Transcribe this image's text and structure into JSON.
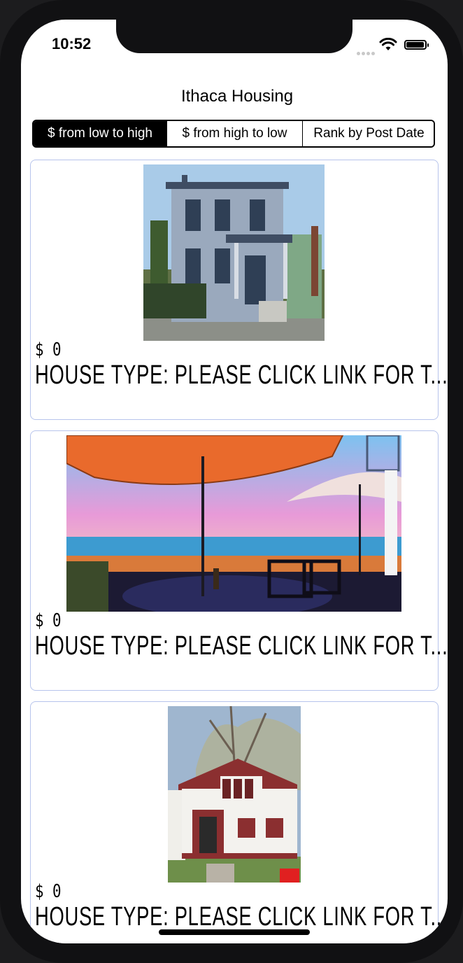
{
  "status_bar": {
    "time": "10:52",
    "battery_level": 0.9,
    "icons": [
      "signal-dots-icon",
      "wifi-icon",
      "battery-icon"
    ]
  },
  "nav": {
    "title": "Ithaca Housing"
  },
  "sort_control": {
    "segments": [
      {
        "label": "$ from low to high",
        "selected": true
      },
      {
        "label": "$ from high to low",
        "selected": false
      },
      {
        "label": "Rank by Post Date",
        "selected": false
      }
    ]
  },
  "listings": [
    {
      "price": "$ 0",
      "house_type": "HOUSE TYPE: PLEASE CLICK LINK FOR T...",
      "image": "victorian-house-photo"
    },
    {
      "price": "$ 0",
      "house_type": "HOUSE TYPE: PLEASE CLICK LINK FOR T...",
      "image": "lake-patio-umbrella-photo"
    },
    {
      "price": "$ 0",
      "house_type": "HOUSE TYPE: PLEASE CLICK LINK FOR T...",
      "image": "white-cottage-photo"
    }
  ],
  "colors": {
    "card_border": "#b7c4ec",
    "segment_selected_bg": "#000000"
  }
}
